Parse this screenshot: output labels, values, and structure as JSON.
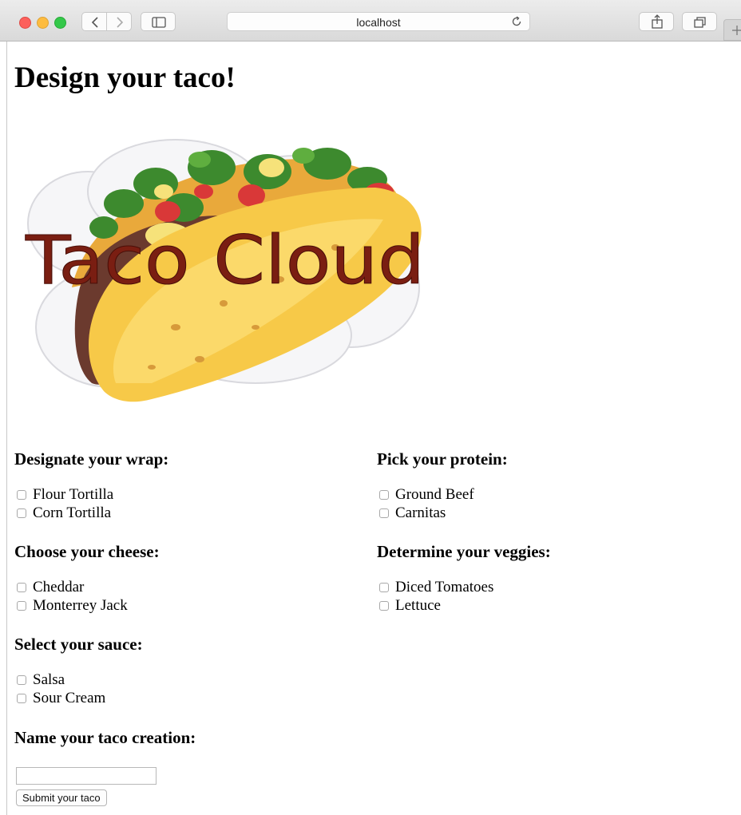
{
  "browser": {
    "address": "localhost",
    "buttons": {
      "back": "chevron-left-icon",
      "forward": "chevron-right-icon",
      "sidebar": "sidebar-icon",
      "reload": "reload-icon",
      "share": "share-icon",
      "tabs": "tabs-icon",
      "new_tab": "plus-icon"
    }
  },
  "page": {
    "title": "Design your taco!",
    "logo_text": "Taco Cloud"
  },
  "groups": {
    "wrap": {
      "heading": "Designate your wrap:",
      "options": [
        "Flour Tortilla",
        "Corn Tortilla"
      ]
    },
    "protein": {
      "heading": "Pick your protein:",
      "options": [
        "Ground Beef",
        "Carnitas"
      ]
    },
    "cheese": {
      "heading": "Choose your cheese:",
      "options": [
        "Cheddar",
        "Monterrey Jack"
      ]
    },
    "veggies": {
      "heading": "Determine your veggies:",
      "options": [
        "Diced Tomatoes",
        "Lettuce"
      ]
    },
    "sauce": {
      "heading": "Select your sauce:",
      "options": [
        "Salsa",
        "Sour Cream"
      ]
    }
  },
  "name_section": {
    "heading": "Name your taco creation:",
    "input_value": "",
    "submit_label": "Submit your taco"
  },
  "colors": {
    "close": "#fc605c",
    "minimize": "#fdbc40",
    "maximize": "#34c84a",
    "logo_text": "#7a1e12",
    "shell": "#f7c948",
    "lettuce": "#3d8a2e",
    "tomato": "#d93838"
  }
}
